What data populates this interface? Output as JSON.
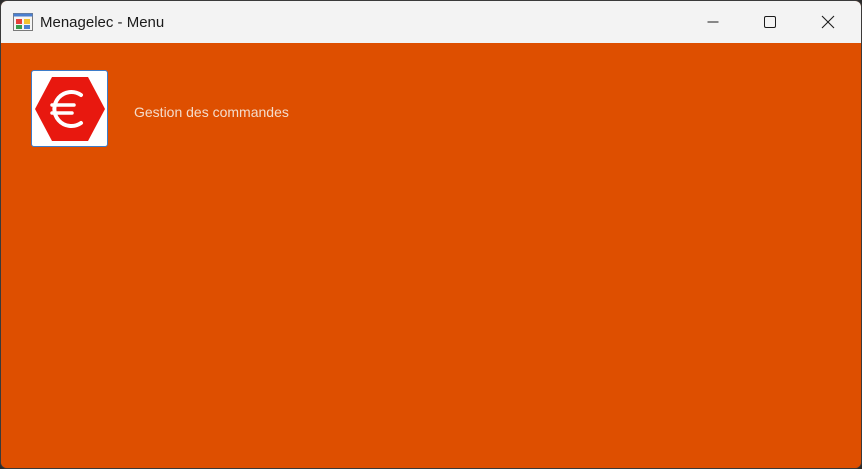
{
  "window": {
    "title": "Menagelec - Menu",
    "background_color": "#de4f00"
  },
  "titlebar": {
    "app_icon": "windows-form-icon",
    "minimize_icon": "minimize-icon",
    "maximize_icon": "maximize-icon",
    "close_icon": "close-icon"
  },
  "menu": {
    "items": [
      {
        "icon": "euro-octagon-icon",
        "icon_color": "#e8180f",
        "label": "Gestion des commandes"
      }
    ]
  }
}
